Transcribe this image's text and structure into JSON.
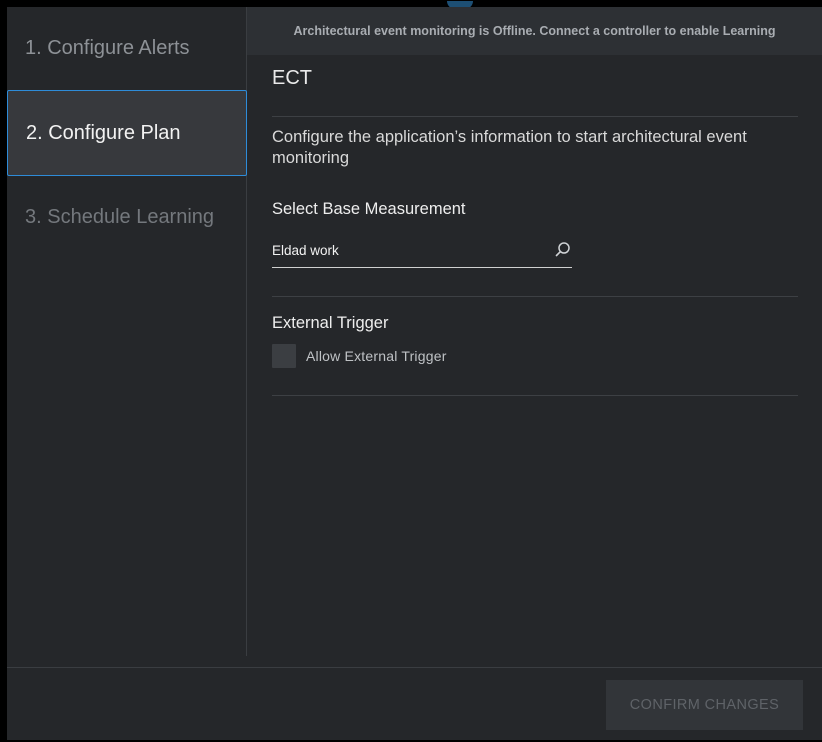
{
  "sidebar": {
    "steps": [
      {
        "label": "1. Configure Alerts"
      },
      {
        "label": "2. Configure Plan"
      },
      {
        "label": "3. Schedule Learning"
      }
    ]
  },
  "banner": {
    "text": "Architectural event monitoring is Offline. Connect a controller to enable Learning"
  },
  "main": {
    "title": "ECT",
    "description": "Configure the application’s information to start architectural event monitoring",
    "base_measurement": {
      "label": "Select Base Measurement",
      "value": "Eldad work",
      "icon": "search-icon"
    },
    "external_trigger": {
      "label": "External Trigger",
      "checkbox_label": "Allow External Trigger",
      "checked": false
    }
  },
  "footer": {
    "confirm_label": "CONFIRM CHANGES"
  },
  "colors": {
    "accent": "#2e8cd9",
    "background": "#25272a",
    "banner": "#2d3034"
  }
}
